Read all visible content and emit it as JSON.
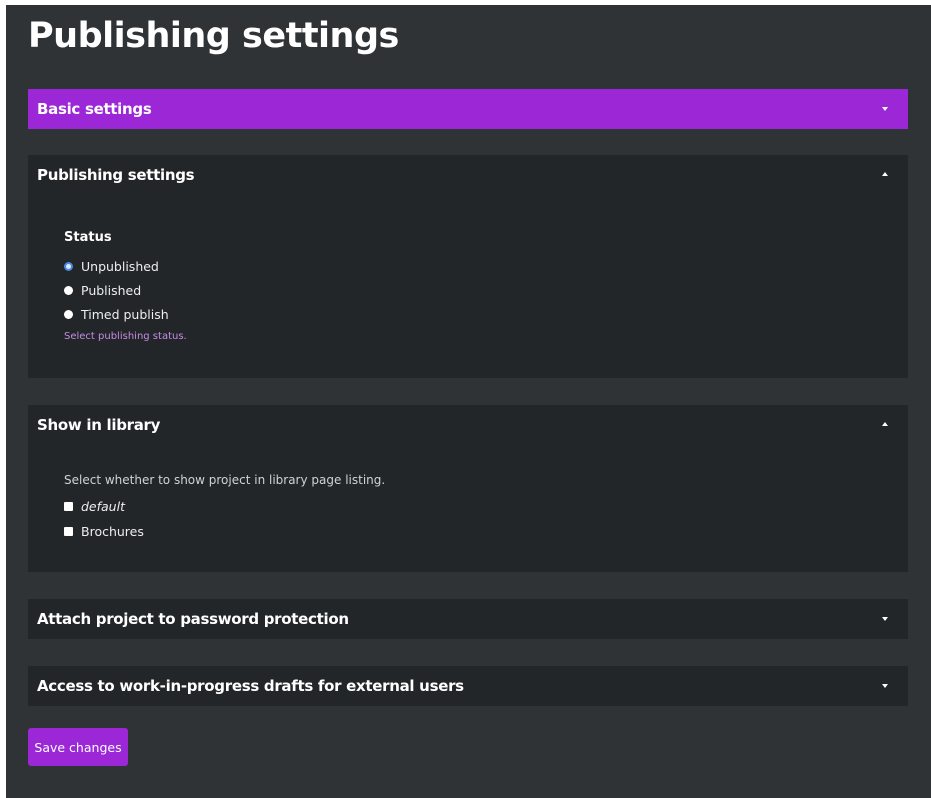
{
  "page": {
    "title": "Publishing settings"
  },
  "panels": {
    "basic": {
      "title": "Basic settings",
      "expanded": false
    },
    "publishing": {
      "title": "Publishing settings",
      "expanded": true,
      "status_label": "Status",
      "options": [
        {
          "label": "Unpublished",
          "checked": true
        },
        {
          "label": "Published",
          "checked": false
        },
        {
          "label": "Timed publish",
          "checked": false
        }
      ],
      "help": "Select publishing status."
    },
    "library": {
      "title": "Show in library",
      "expanded": true,
      "description": "Select whether to show project in library page listing.",
      "options": [
        {
          "label": "default",
          "checked": false
        },
        {
          "label": "Brochures",
          "checked": false
        }
      ]
    },
    "password": {
      "title": "Attach project to password protection",
      "expanded": false
    },
    "drafts": {
      "title": "Access to work-in-progress drafts for external users",
      "expanded": false
    }
  },
  "actions": {
    "save_label": "Save changes"
  },
  "colors": {
    "accent": "#9b27d6",
    "background": "#2f3336",
    "panel": "#232629",
    "help_text": "#c58be6"
  },
  "icons": {
    "collapsed": "caret-down-icon",
    "expanded": "caret-up-icon"
  }
}
